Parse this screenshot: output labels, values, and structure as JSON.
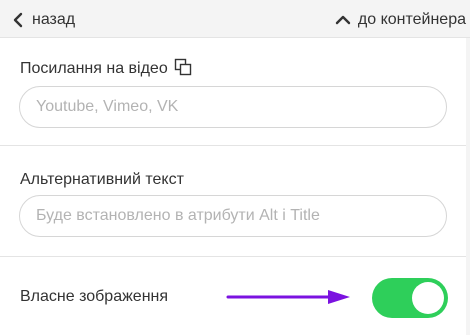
{
  "topbar": {
    "back_label": "назад",
    "up_label": "до контейнера",
    "back_icon": "chevron-left-icon",
    "up_icon": "chevron-up-icon"
  },
  "video_link": {
    "label": "Посилання на відео",
    "icon": "copy-icon",
    "value": "",
    "placeholder": "Youtube, Vimeo, VK"
  },
  "alt_text": {
    "label": "Альтернативний текст",
    "value": "",
    "placeholder": "Буде встановлено в атрибути Alt і Title"
  },
  "own_image": {
    "label": "Власне зображення",
    "enabled": true,
    "toggle_color": "#2ecf5a"
  },
  "annotation": {
    "arrow_color": "#7b12e0"
  }
}
